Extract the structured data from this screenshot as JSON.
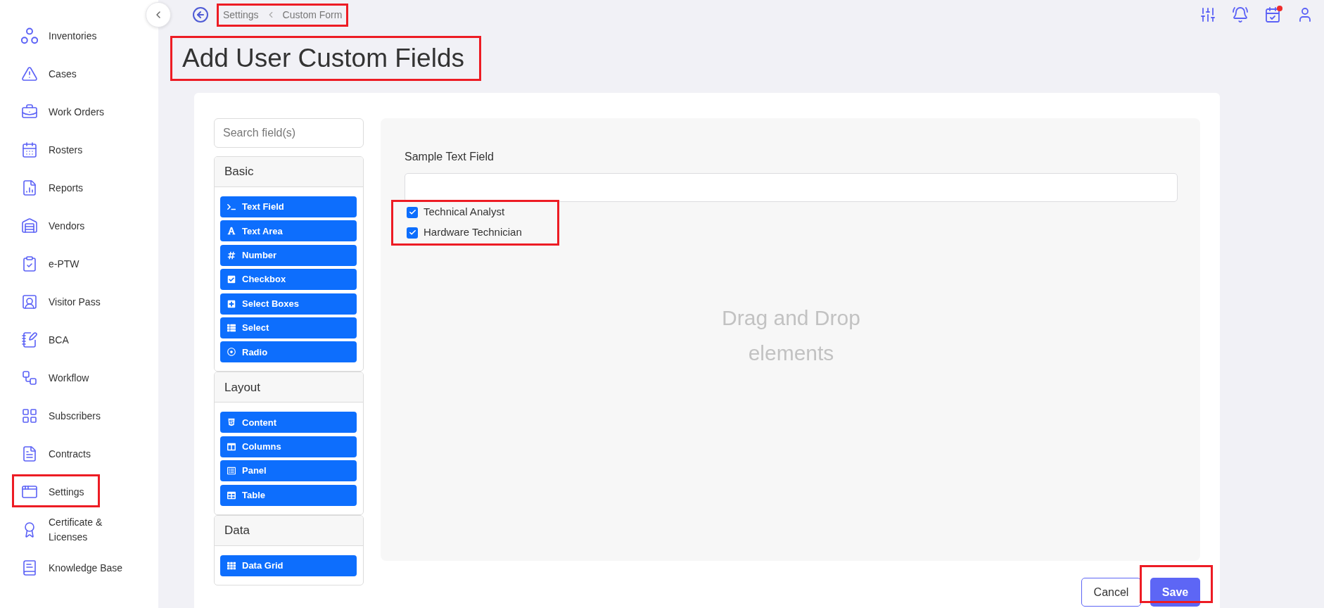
{
  "sidebar": {
    "items": [
      {
        "label": "Inventories",
        "highlighted": false
      },
      {
        "label": "Cases",
        "highlighted": false
      },
      {
        "label": "Work Orders",
        "highlighted": false
      },
      {
        "label": "Rosters",
        "highlighted": false
      },
      {
        "label": "Reports",
        "highlighted": false
      },
      {
        "label": "Vendors",
        "highlighted": false
      },
      {
        "label": "e-PTW",
        "highlighted": false
      },
      {
        "label": "Visitor Pass",
        "highlighted": false
      },
      {
        "label": "BCA",
        "highlighted": false
      },
      {
        "label": "Workflow",
        "highlighted": false
      },
      {
        "label": "Subscribers",
        "highlighted": false
      },
      {
        "label": "Contracts",
        "highlighted": false
      },
      {
        "label": "Settings",
        "highlighted": true
      },
      {
        "label": "Certificate & Licenses",
        "highlighted": false
      },
      {
        "label": "Knowledge Base",
        "highlighted": false
      }
    ]
  },
  "top_bar": {
    "breadcrumb": [
      "Settings",
      "Custom Form"
    ],
    "breadcrumb_highlighted": true,
    "tasks_badge": true
  },
  "page": {
    "title": "Add User Custom Fields",
    "title_highlighted": true
  },
  "palette": {
    "search": {
      "placeholder": "Search field(s)"
    },
    "groups": [
      {
        "title": "Basic",
        "items": [
          "Text Field",
          "Text Area",
          "Number",
          "Checkbox",
          "Select Boxes",
          "Select",
          "Radio"
        ]
      },
      {
        "title": "Layout",
        "items": [
          "Content",
          "Columns",
          "Panel",
          "Table"
        ]
      },
      {
        "title": "Data",
        "items": [
          "Data Grid"
        ]
      }
    ]
  },
  "canvas": {
    "field": {
      "label": "Sample Text Field"
    },
    "options": [
      {
        "label": "Technical Analyst",
        "checked": true
      },
      {
        "label": "Hardware Technician",
        "checked": true
      }
    ],
    "options_highlighted": true,
    "hint": "Drag and Drop elements"
  },
  "actions": [
    {
      "label": "Cancel",
      "kind": "secondary",
      "highlighted": false
    },
    {
      "label": "Save",
      "kind": "primary",
      "highlighted": true
    }
  ]
}
